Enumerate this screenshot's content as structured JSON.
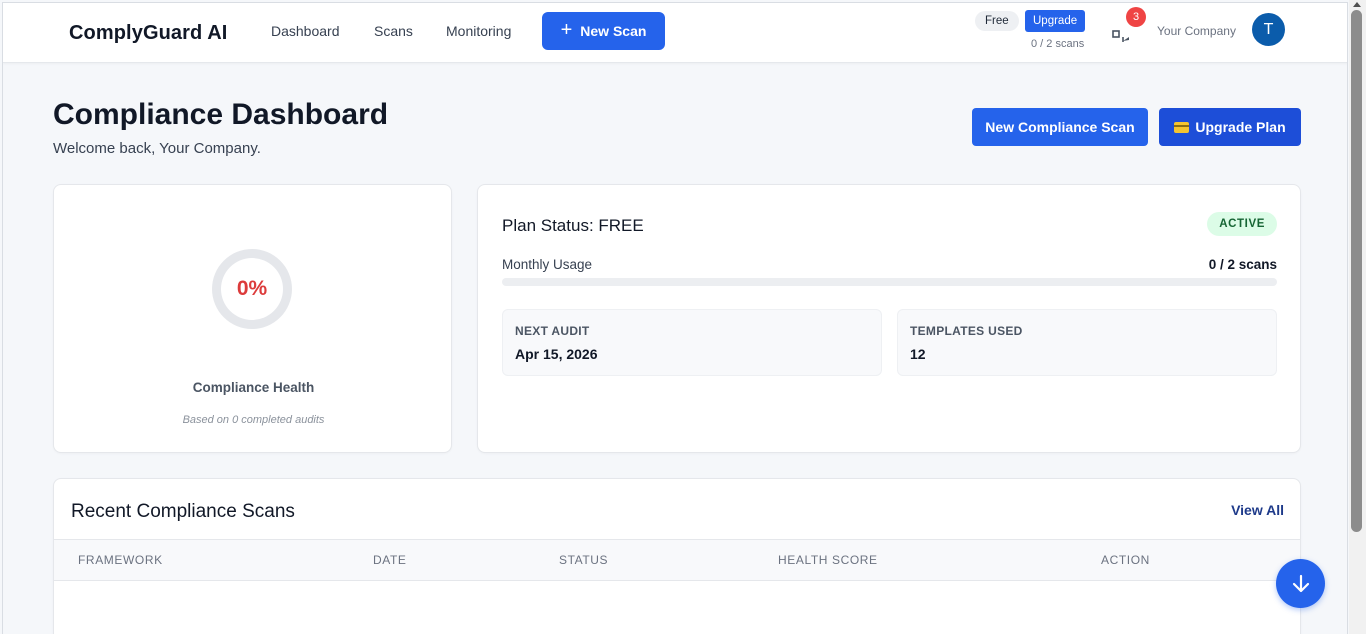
{
  "header": {
    "brand": "ComplyGuard AI",
    "nav": [
      "Dashboard",
      "Scans",
      "Monitoring"
    ],
    "new_scan_label": "New Scan",
    "plan_badge": "Free",
    "upgrade_label": "Upgrade",
    "usage": "0 / 2 scans",
    "notification_count": "3",
    "company": "Your Company",
    "avatar_initial": "T"
  },
  "page": {
    "title": "Compliance Dashboard",
    "welcome": "Welcome back, Your Company.",
    "new_compliance_scan_label": "New Compliance Scan",
    "upgrade_plan_label": "Upgrade Plan"
  },
  "health": {
    "percent": "0%",
    "label": "Compliance Health",
    "subtext": "Based on 0 completed audits"
  },
  "plan": {
    "title": "Plan Status: FREE",
    "status_badge": "ACTIVE",
    "usage_label": "Monthly Usage",
    "usage_value": "0 / 2 scans",
    "usage_fraction": 0,
    "next_audit_label": "NEXT AUDIT",
    "next_audit_value": "Apr 15, 2026",
    "templates_label": "TEMPLATES USED",
    "templates_value": "12"
  },
  "scans": {
    "title": "Recent Compliance Scans",
    "view_all": "View All",
    "columns": [
      "FRAMEWORK",
      "DATE",
      "STATUS",
      "HEALTH SCORE",
      "ACTION"
    ],
    "rows": []
  },
  "colors": {
    "accent": "#2563eb",
    "health_text": "#dc3b3b",
    "active_badge_bg": "#dcfce7",
    "active_badge_text": "#166534"
  },
  "icons": {
    "plus": "plus-icon",
    "notifications": "notifications-icon",
    "card": "credit-card-icon",
    "scroll_down": "arrow-down-icon"
  }
}
